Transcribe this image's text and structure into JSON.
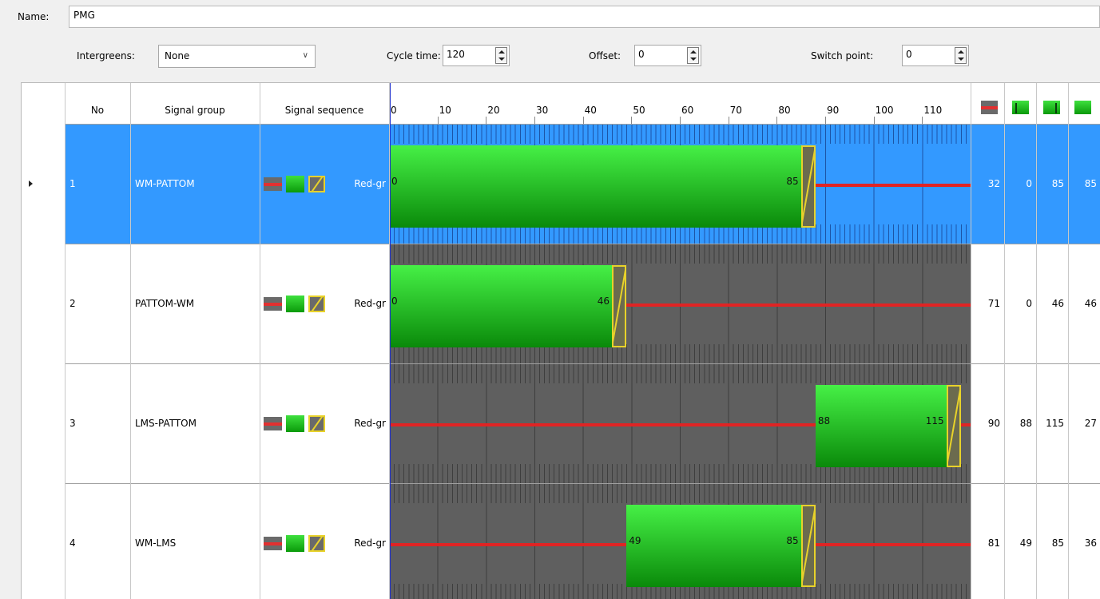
{
  "form": {
    "name_label": "Name:",
    "name_value": "PMG",
    "intergreens_label": "Intergreens:",
    "intergreens_value": "None",
    "cycle_label": "Cycle time:",
    "cycle_value": "120",
    "offset_label": "Offset:",
    "offset_value": "0",
    "switch_label": "Switch point:",
    "switch_value": "0"
  },
  "columns": {
    "no": "No",
    "signal_group": "Signal group",
    "signal_sequence": "Signal sequence",
    "ticks": [
      "0",
      "10",
      "20",
      "30",
      "40",
      "50",
      "60",
      "70",
      "80",
      "90",
      "100",
      "110"
    ],
    "summary_icons": [
      "red-duration-icon",
      "green-start-icon",
      "green-end-icon",
      "green-duration-icon"
    ]
  },
  "cycle_time": 120,
  "rows": [
    {
      "no": "1",
      "group": "WM-PATTOM",
      "sequence": "Red-gr",
      "green_start": 0,
      "green_end": 85,
      "start_label": "0",
      "end_label": "85",
      "red": "32",
      "gs": "0",
      "ge": "85",
      "gd": "85",
      "selected": true
    },
    {
      "no": "2",
      "group": "PATTOM-WM",
      "sequence": "Red-gr",
      "green_start": 0,
      "green_end": 46,
      "start_label": "0",
      "end_label": "46",
      "red": "71",
      "gs": "0",
      "ge": "46",
      "gd": "46",
      "selected": false
    },
    {
      "no": "3",
      "group": "LMS-PATTOM",
      "sequence": "Red-gr",
      "green_start": 88,
      "green_end": 115,
      "start_label": "88",
      "end_label": "115",
      "red": "90",
      "gs": "88",
      "ge": "115",
      "gd": "27",
      "selected": false
    },
    {
      "no": "4",
      "group": "WM-LMS",
      "sequence": "Red-gr",
      "green_start": 49,
      "green_end": 85,
      "start_label": "49",
      "end_label": "85",
      "red": "81",
      "gs": "49",
      "ge": "85",
      "gd": "36",
      "selected": false
    }
  ]
}
